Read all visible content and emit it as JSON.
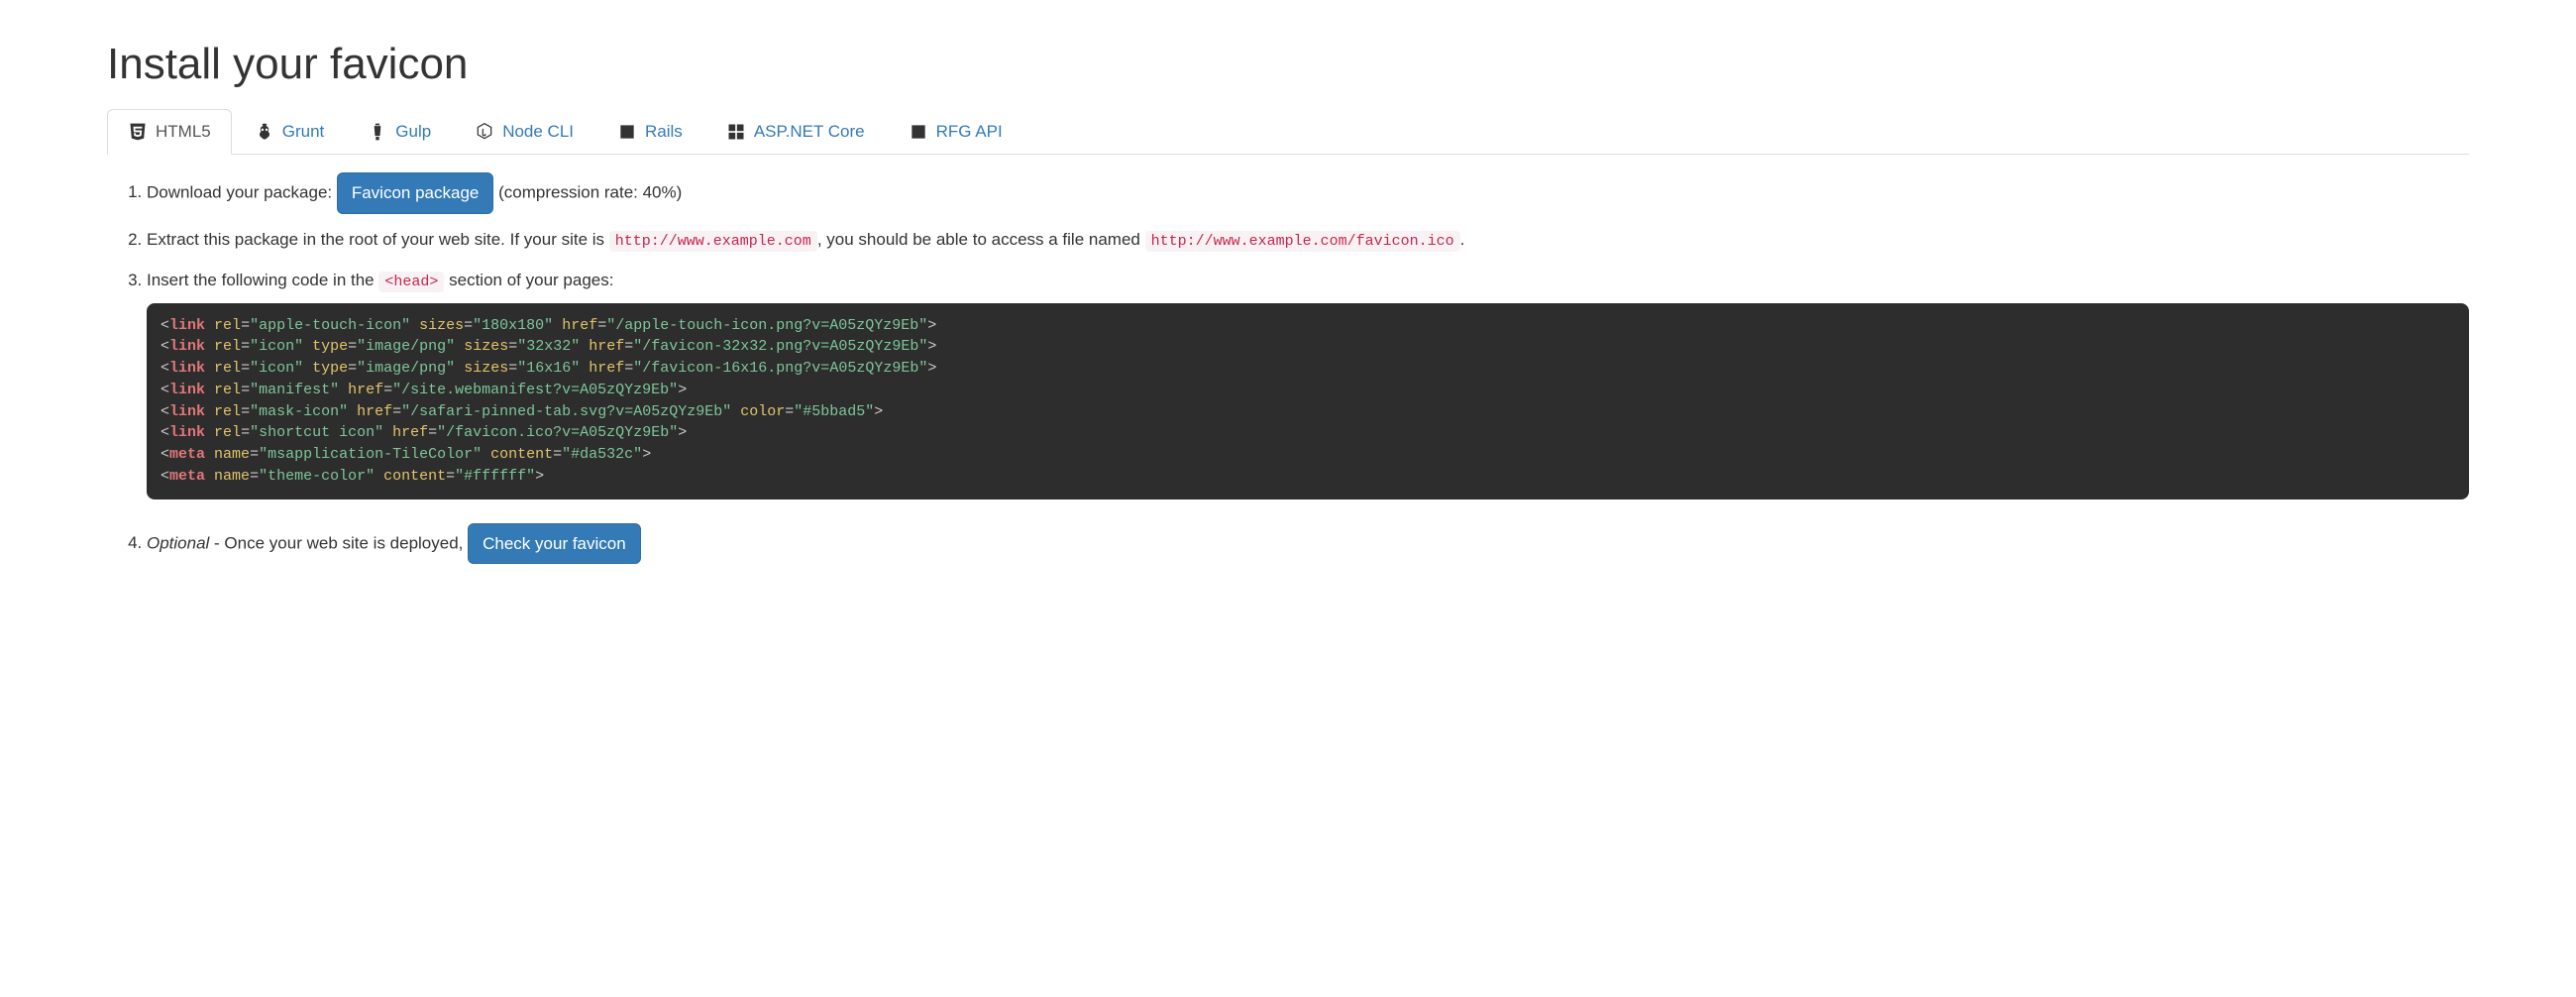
{
  "heading": "Install your favicon",
  "tabs": [
    {
      "id": "html5",
      "label": "HTML5"
    },
    {
      "id": "grunt",
      "label": "Grunt"
    },
    {
      "id": "gulp",
      "label": "Gulp"
    },
    {
      "id": "node-cli",
      "label": "Node CLI"
    },
    {
      "id": "rails",
      "label": "Rails"
    },
    {
      "id": "aspnet",
      "label": "ASP.NET Core"
    },
    {
      "id": "rfg-api",
      "label": "RFG API"
    }
  ],
  "steps": {
    "step1": {
      "prefix": "Download your package: ",
      "button": "Favicon package",
      "suffix": " (compression rate: 40%)"
    },
    "step2": {
      "part1": "Extract this package in the root of your web site. If your site is ",
      "code1": "http://www.example.com",
      "part2": ", you should be able to access a file named ",
      "code2": "http://www.example.com/favicon.ico",
      "part3": "."
    },
    "step3": {
      "part1": "Insert the following code in the ",
      "code1": "<head>",
      "part2": " section of your pages:"
    },
    "code_lines": [
      {
        "tag": "link",
        "attrs": [
          [
            "rel",
            "apple-touch-icon"
          ],
          [
            "sizes",
            "180x180"
          ],
          [
            "href",
            "/apple-touch-icon.png?v=A05zQYz9Eb"
          ]
        ]
      },
      {
        "tag": "link",
        "attrs": [
          [
            "rel",
            "icon"
          ],
          [
            "type",
            "image/png"
          ],
          [
            "sizes",
            "32x32"
          ],
          [
            "href",
            "/favicon-32x32.png?v=A05zQYz9Eb"
          ]
        ]
      },
      {
        "tag": "link",
        "attrs": [
          [
            "rel",
            "icon"
          ],
          [
            "type",
            "image/png"
          ],
          [
            "sizes",
            "16x16"
          ],
          [
            "href",
            "/favicon-16x16.png?v=A05zQYz9Eb"
          ]
        ]
      },
      {
        "tag": "link",
        "attrs": [
          [
            "rel",
            "manifest"
          ],
          [
            "href",
            "/site.webmanifest?v=A05zQYz9Eb"
          ]
        ]
      },
      {
        "tag": "link",
        "attrs": [
          [
            "rel",
            "mask-icon"
          ],
          [
            "href",
            "/safari-pinned-tab.svg?v=A05zQYz9Eb"
          ],
          [
            "color",
            "#5bbad5"
          ]
        ]
      },
      {
        "tag": "link",
        "attrs": [
          [
            "rel",
            "shortcut icon"
          ],
          [
            "href",
            "/favicon.ico?v=A05zQYz9Eb"
          ]
        ]
      },
      {
        "tag": "meta",
        "attrs": [
          [
            "name",
            "msapplication-TileColor"
          ],
          [
            "content",
            "#da532c"
          ]
        ]
      },
      {
        "tag": "meta",
        "attrs": [
          [
            "name",
            "theme-color"
          ],
          [
            "content",
            "#ffffff"
          ]
        ]
      }
    ],
    "step4": {
      "optional": "Optional",
      "mid": " - Once your web site is deployed, ",
      "button": "Check your favicon"
    }
  }
}
